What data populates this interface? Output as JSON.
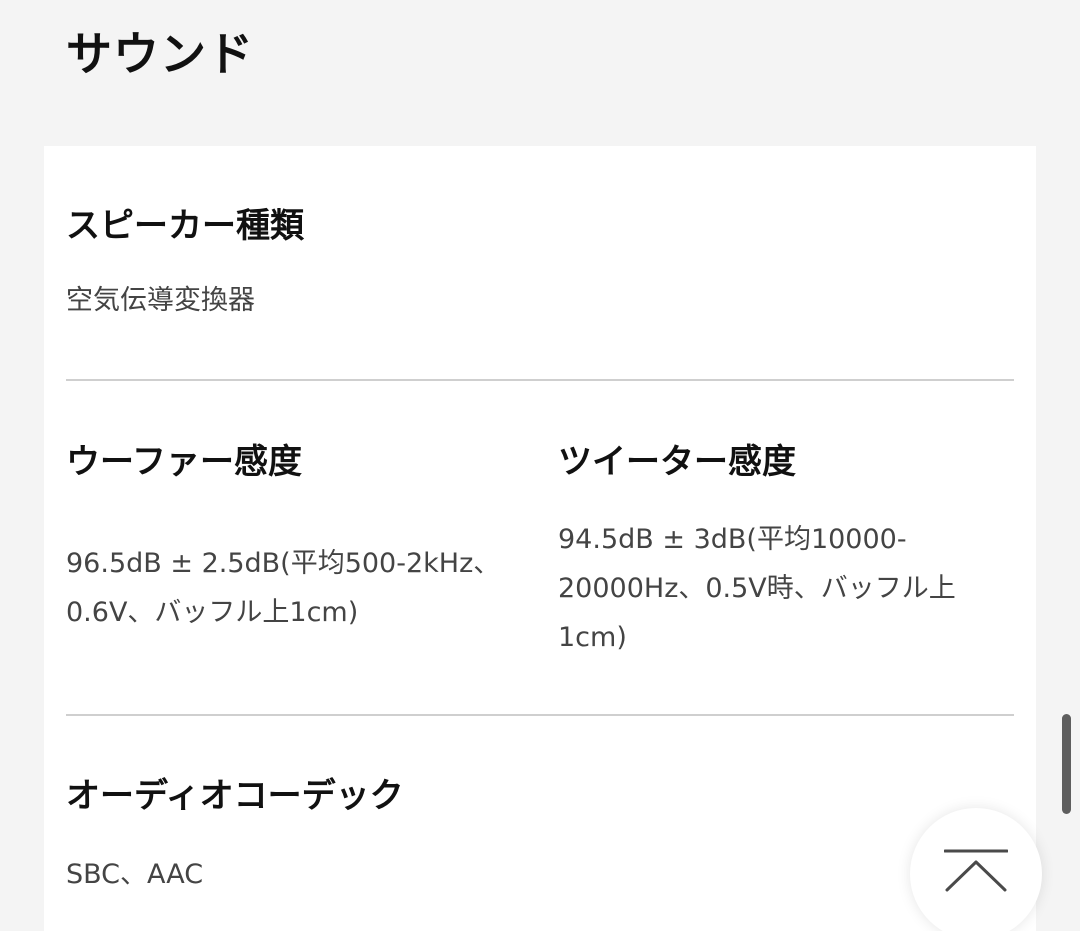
{
  "section": {
    "title": "サウンド"
  },
  "specs": {
    "speaker_type": {
      "label": "スピーカー種類",
      "value": "空気伝導変換器"
    },
    "woofer_sensitivity": {
      "label": "ウーファー感度",
      "value_line1": "96.5dB ± 2.5dB(平均500-2kHz、",
      "value_line2": "0.6V、バッフル上1cm)"
    },
    "tweeter_sensitivity": {
      "label": "ツイーター感度",
      "value_line1": "94.5dB ± 3dB(平均10000-",
      "value_line2": "20000Hz、0.5V時、バッフル上",
      "value_line3": "1cm)"
    },
    "audio_codec": {
      "label": "オーディオコーデック",
      "value": "SBC、AAC"
    }
  },
  "back_to_top": {
    "icon": "chevron-up-icon"
  },
  "colors": {
    "page_background": "#f4f4f4",
    "card_background": "#ffffff",
    "divider": "#cfcfcf",
    "label_text": "#111111",
    "value_text": "#444444"
  }
}
